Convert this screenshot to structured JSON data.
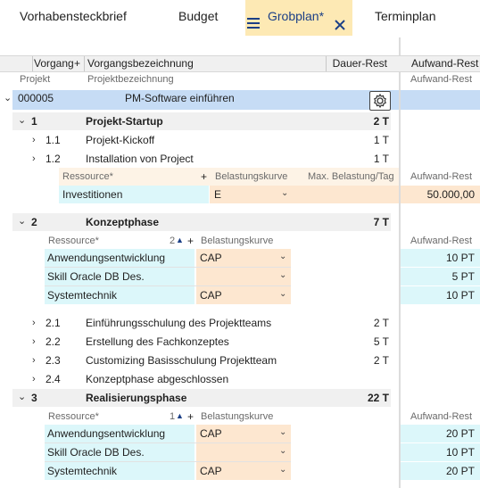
{
  "tabs": [
    {
      "label": "Vorhabensteckbrief"
    },
    {
      "label": "Budget"
    },
    {
      "label": "Grobplan*"
    },
    {
      "label": "Terminplan"
    }
  ],
  "header": {
    "col_vorgang": "Vorgang",
    "col_plus": "+",
    "col_bezeichnung": "Vorgangsbezeichnung",
    "col_dauer": "Dauer-Rest",
    "col_aufwand": "Aufwand-Rest",
    "sub_projekt": "Projekt",
    "sub_projektbezeichnung": "Projektbezeichnung",
    "sub_aufwand": "Aufwand-Rest"
  },
  "project": {
    "id": "000005",
    "name": "PM-Software einführen"
  },
  "phase1": {
    "num": "1",
    "name": "Projekt-Startup",
    "duration": "2 T",
    "tasks": [
      {
        "num": "1.1",
        "name": "Projekt-Kickoff",
        "duration": "1 T"
      },
      {
        "num": "1.2",
        "name": "Installation von Project",
        "duration": "1 T"
      }
    ],
    "res_header": {
      "ressource": "Ressource*",
      "plus": "+",
      "kurve": "Belastungskurve",
      "max": "Max. Belastung/Tag",
      "aufwand": "Aufwand-Rest"
    },
    "resources": [
      {
        "name": "Investitionen",
        "kurve": "E",
        "aufwand": "50.000,00"
      }
    ]
  },
  "phase2": {
    "num": "2",
    "name": "Konzeptphase",
    "duration": "7 T",
    "res_header": {
      "ressource": "Ressource*",
      "sort": "2",
      "plus": "+",
      "kurve": "Belastungskurve",
      "aufwand": "Aufwand-Rest"
    },
    "resources": [
      {
        "name": "Anwendungsentwicklung",
        "kurve": "CAP",
        "aufwand": "10 PT"
      },
      {
        "name": "Skill Oracle DB Des.",
        "kurve": "",
        "aufwand": "5 PT"
      },
      {
        "name": "Systemtechnik",
        "kurve": "CAP",
        "aufwand": "10 PT"
      }
    ],
    "tasks": [
      {
        "num": "2.1",
        "name": "Einführungsschulung des Projektteams",
        "duration": "2 T"
      },
      {
        "num": "2.2",
        "name": "Erstellung des Fachkonzeptes",
        "duration": "5 T"
      },
      {
        "num": "2.3",
        "name": "Customizing Basisschulung Projektteam",
        "duration": "2 T"
      },
      {
        "num": "2.4",
        "name": "Konzeptphase abgeschlossen",
        "duration": ""
      }
    ]
  },
  "phase3": {
    "num": "3",
    "name": "Realisierungsphase",
    "duration": "22 T",
    "res_header": {
      "ressource": "Ressource*",
      "sort": "1",
      "plus": "+",
      "kurve": "Belastungskurve",
      "aufwand": "Aufwand-Rest"
    },
    "resources": [
      {
        "name": "Anwendungsentwicklung",
        "kurve": "CAP",
        "aufwand": "20 PT"
      },
      {
        "name": "Skill Oracle DB Des.",
        "kurve": "",
        "aufwand": "10 PT"
      },
      {
        "name": "Systemtechnik",
        "kurve": "CAP",
        "aufwand": "20 PT"
      }
    ]
  },
  "colors": {
    "active_tab": "#fde9b4",
    "selection": "#c6dcf5",
    "cyan_cell": "#dcf7fa",
    "peach_cell": "#fde7d0",
    "close_x": "#1b3f86"
  }
}
